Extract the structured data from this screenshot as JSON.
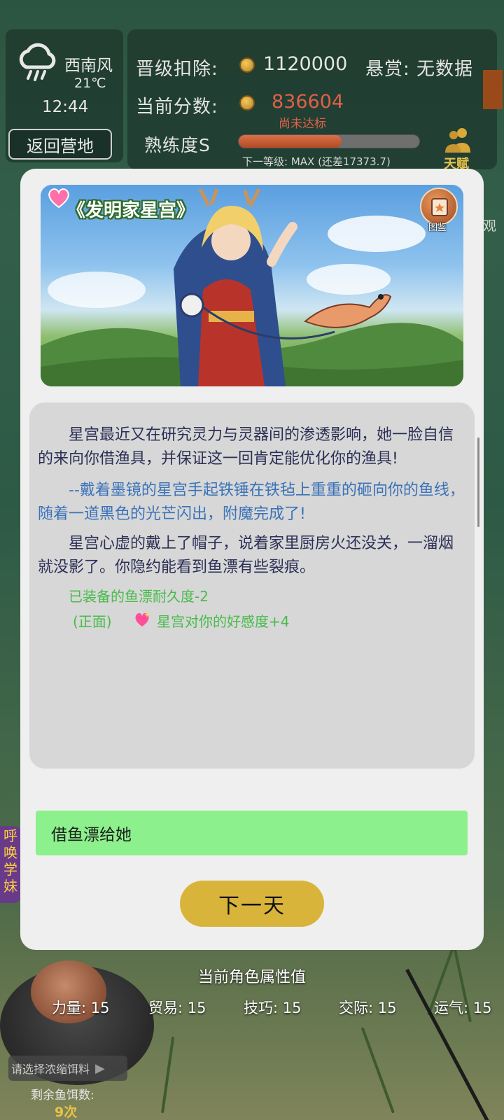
{
  "hud": {
    "weather_icon": "rain-cloud-icon",
    "wind": "西南风",
    "temperature": "21℃",
    "time": "12:44",
    "return_button": "返回营地",
    "promote_deduct_label": "晋级扣除:",
    "promote_deduct_value": "1120000",
    "bounty": "悬赏: 无数据",
    "current_score_label": "当前分数:",
    "current_score_value": "836604",
    "not_reached": "尚未达标",
    "proficiency": "熟练度S",
    "progress": 0.57,
    "next_level": "下一等级: MAX (还差17373.7)",
    "talent_label": "天赋",
    "side_right_text": "观",
    "side_left_text": "呼唤学妹"
  },
  "event": {
    "title": "《发明家星宫》",
    "gallery_label": "图鉴",
    "paragraphs": [
      "星宫最近又在研究灵力与灵器间的渗透影响，她一脸自信的来向你借渔具，并保证这一回肯定能优化你的渔具!",
      "--戴着墨镜的星宫手起铁锤在铁毡上重重的砸向你的鱼线，随着一道黑色的光芒闪出，附魔完成了!",
      "星宫心虚的戴上了帽子，说着家里厨房火还没关，一溜烟就没影了。你隐约能看到鱼漂有些裂痕。"
    ],
    "effect_1": "已装备的鱼漂耐久度-2",
    "effect_2_prefix": "(正面)",
    "effect_2": "星宫对你的好感度+4",
    "option": "借鱼漂给她",
    "next_button": "下一天"
  },
  "attributes": {
    "title": "当前角色属性值",
    "items": [
      {
        "label": "力量: 15"
      },
      {
        "label": "贸易: 15"
      },
      {
        "label": "技巧: 15"
      },
      {
        "label": "交际: 15"
      },
      {
        "label": "运气: 15"
      }
    ]
  },
  "bait": {
    "select": "请选择浓缩饵料",
    "remaining_label": "剩余鱼饵数:",
    "remaining_value": "9次"
  },
  "colors": {
    "option_bg": "#8cf08c",
    "next_bg": "#d8b43a",
    "score_red": "#e0604a",
    "effect_green": "#48bb4a"
  }
}
